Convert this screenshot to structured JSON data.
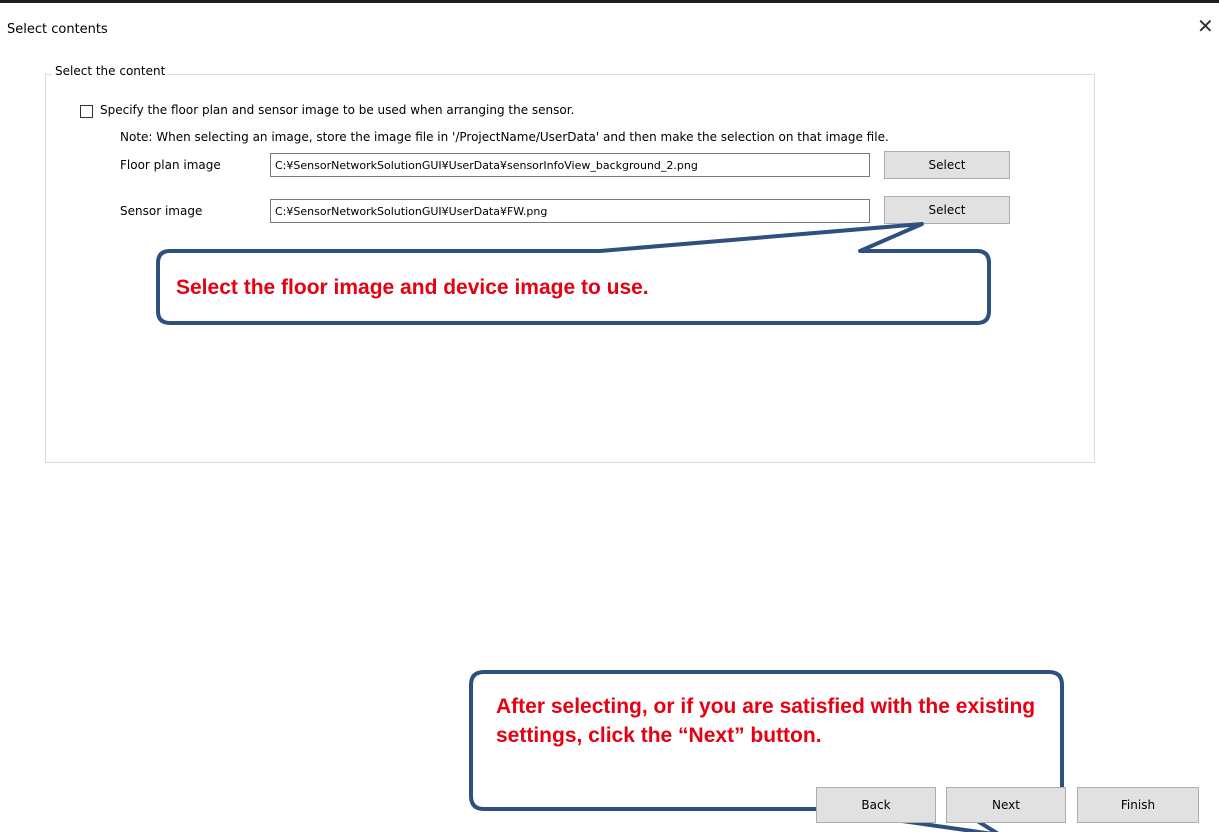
{
  "window": {
    "title": "Select contents",
    "close_icon": "close-icon"
  },
  "group": {
    "legend": "Select the content"
  },
  "options": {
    "specify_checkbox_label": "Specify the floor plan and sensor image to be used when arranging the sensor.",
    "specify_checked": false,
    "note": "Note: When selecting an image, store the image file in '/ProjectName/UserData' and then make the selection on that image file."
  },
  "floor_plan": {
    "label": "Floor plan image",
    "value": "C:¥SensorNetworkSolutionGUI¥UserData¥sensorInfoView_background_2.png",
    "select_label": "Select"
  },
  "sensor_image": {
    "label": "Sensor image",
    "value": "C:¥SensorNetworkSolutionGUI¥UserData¥FW.png",
    "select_label": "Select"
  },
  "callouts": {
    "select_images": "Select the floor image and device image to use.",
    "next_instruction": "After selecting, or if you are satisfied with the existing settings, click the “Next” button.",
    "text_color": "#e60012",
    "border_color": "#2f4f7f"
  },
  "footer": {
    "back_label": "Back",
    "next_label": "Next",
    "finish_label": "Finish"
  }
}
